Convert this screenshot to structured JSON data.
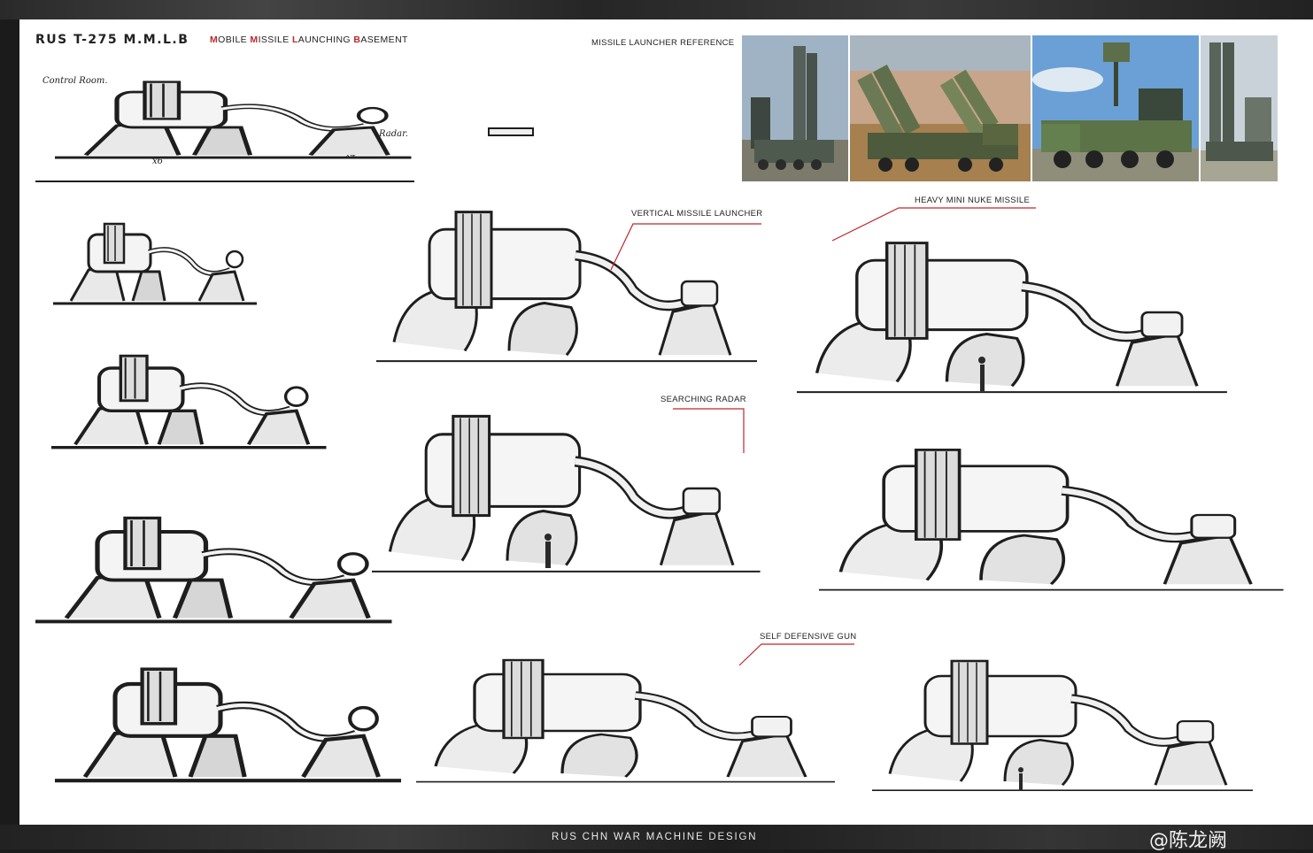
{
  "header": {
    "title": "RUS T-275 M.M.L.B",
    "subtitle_parts": [
      {
        "text": "M",
        "accent": true
      },
      {
        "text": "OBILE ",
        "accent": false
      },
      {
        "text": "M",
        "accent": true
      },
      {
        "text": "ISSILE ",
        "accent": false
      },
      {
        "text": "L",
        "accent": true
      },
      {
        "text": "AUNCHING ",
        "accent": false
      },
      {
        "text": "B",
        "accent": true
      },
      {
        "text": "ASEMENT",
        "accent": false
      }
    ],
    "accent_color": "#c0262b"
  },
  "reference": {
    "label": "MISSILE LAUNCHER REFERENCE",
    "photos": [
      {
        "name": "reference-photo-s300-tall-tubes"
      },
      {
        "name": "reference-photo-desert-launcher"
      },
      {
        "name": "reference-photo-radar-truck"
      },
      {
        "name": "reference-photo-twin-tubes"
      }
    ]
  },
  "annotations": {
    "control_room": "Control Room.",
    "radar": "Radar.",
    "x6": "x6",
    "x4": "x4",
    "vertical_missile_launcher": "VERTICAL MISSILE LAUNCHER",
    "heavy_mini_nuke_missile": "HEAVY MINI NUKE MISSILE",
    "searching_radar": "SEARCHING RADAR",
    "self_defensive_gun": "SELF DEFENSIVE GUN"
  },
  "footer": {
    "text": "RUS CHN WAR MACHINE DESIGN",
    "watermark": "@陈龙阙"
  },
  "colors": {
    "ink": "#222222",
    "callout_line": "#c0262b",
    "sheet": "#ffffff",
    "frame": "#1b1b1b"
  }
}
